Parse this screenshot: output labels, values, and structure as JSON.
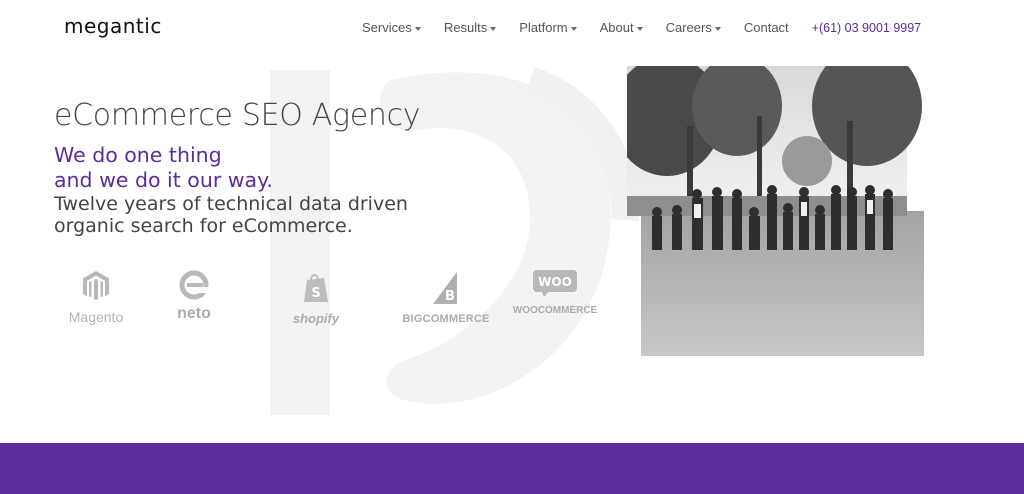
{
  "brand": {
    "logo_text": "megantic",
    "accent": "#5b2d9a"
  },
  "nav": {
    "items": [
      {
        "label": "Services",
        "has_dropdown": true
      },
      {
        "label": "Results",
        "has_dropdown": true
      },
      {
        "label": "Platform",
        "has_dropdown": true
      },
      {
        "label": "About",
        "has_dropdown": true
      },
      {
        "label": "Careers",
        "has_dropdown": true
      },
      {
        "label": "Contact",
        "has_dropdown": false
      }
    ],
    "phone": "+(61) 03 9001 9997"
  },
  "hero": {
    "title": "eCommerce SEO Agency",
    "tagline_line1": "We do one thing",
    "tagline_line2": "and we do it our way.",
    "sub_line1": "Twelve years of technical data driven",
    "sub_line2": "organic search for eCommerce."
  },
  "platforms": [
    {
      "name": "Magento",
      "icon": "magento-icon"
    },
    {
      "name": "neto",
      "icon": "neto-icon"
    },
    {
      "name": "shopify",
      "icon": "shopify-bag-icon"
    },
    {
      "name": "BIGCOMMERCE",
      "icon": "bigcommerce-icon"
    },
    {
      "name": "WOOCOMMERCE",
      "badge": "WOO",
      "icon": "woocommerce-icon"
    }
  ],
  "photo": {
    "icon": "team-photo",
    "style": "black-and-white"
  },
  "watermark": {
    "icon": "ten-years-watermark-icon"
  }
}
